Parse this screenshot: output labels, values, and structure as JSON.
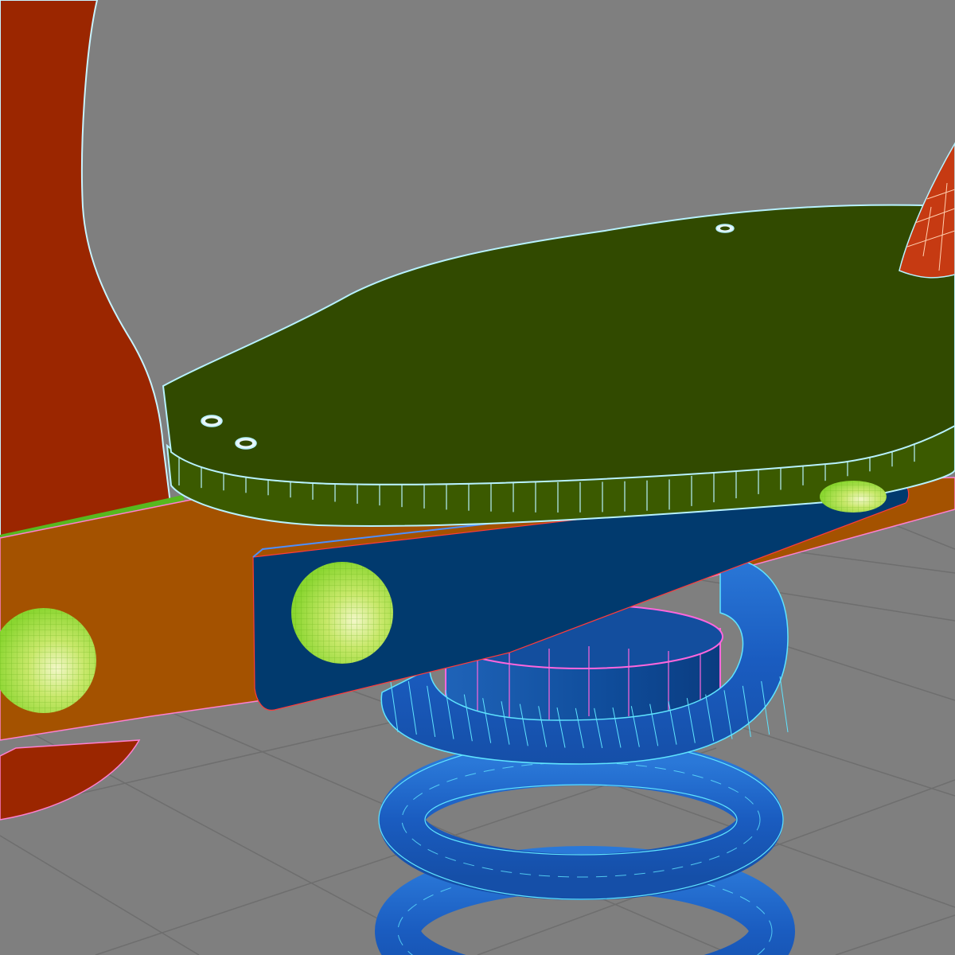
{
  "viewport": {
    "background": "#7f7f7f",
    "grid_color": "#8f8f8f",
    "grid_shadow": "#6e6e6e"
  },
  "model": {
    "red_frame": "#9b2600",
    "red_frame_edge": "#c8f4ff",
    "handle": "#c63a12",
    "beam": "#a45200",
    "beam_edge_pink": "#ff7fd0",
    "green_strip": "#57b81e",
    "seat_top": "#314a00",
    "seat_rim": "#3b5a00",
    "wire": "#b8f2ff",
    "bracket": "#013a6e",
    "bracket_edge": "#4c8fff",
    "hub": "#0f4c9a",
    "hub_wire_pink": "#ff66dd",
    "spring": "#1b5fc4",
    "spring_wire": "#5fe4ff",
    "bolt_dark": "#8ad630",
    "bolt_light": "#e9f3b0",
    "bolt_wire": "#6fbf1e"
  }
}
